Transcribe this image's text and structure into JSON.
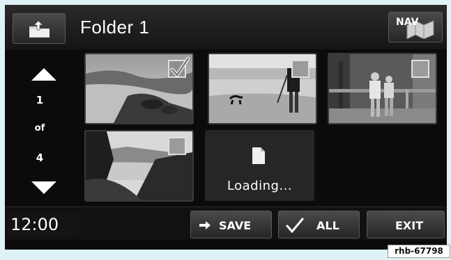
{
  "header": {
    "title": "Folder 1",
    "nav_label": "NAV",
    "up_folder_icon": "folder-up-icon",
    "nav_icon": "map-icon"
  },
  "sidebar": {
    "current_page": "1",
    "of_label": "of",
    "total_pages": "4",
    "up_icon": "triangle-up-icon",
    "down_icon": "triangle-down-icon"
  },
  "photos": [
    {
      "name": "coastline",
      "selected": true
    },
    {
      "name": "dog-and-person-on-beach",
      "selected": false
    },
    {
      "name": "two-people-at-fence",
      "selected": false
    },
    {
      "name": "trees-and-bay",
      "selected": false
    }
  ],
  "loading": {
    "label": "Loading...",
    "icon": "document-icon"
  },
  "footer": {
    "clock": "12:00",
    "save_label": "SAVE",
    "all_label": "ALL",
    "exit_label": "EXIT",
    "save_icon": "arrow-right-icon",
    "all_icon": "checkmark-icon"
  },
  "watermark": "rhb-67798",
  "colors": {
    "background": "#0b0b0b",
    "frame": "#dff3f7",
    "button": "#3a3a3a",
    "text": "#ffffff"
  }
}
